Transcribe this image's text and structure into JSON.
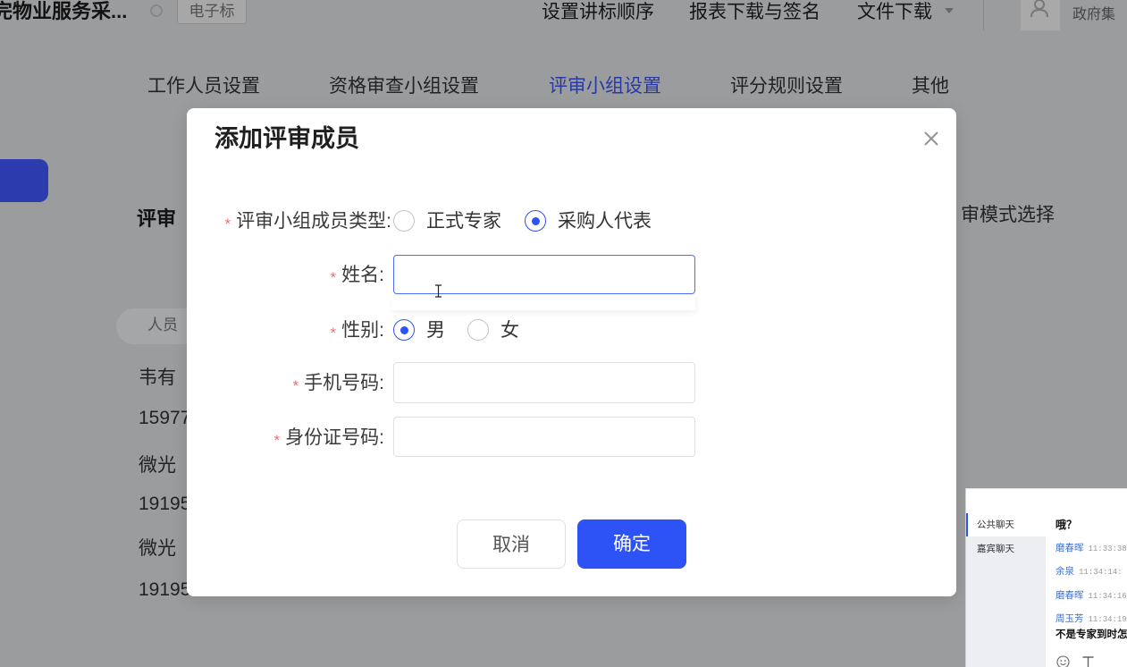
{
  "theme": {
    "primary": "#2d52f5",
    "required": "#f56c6c",
    "chat_name": "#3a6fd0"
  },
  "header": {
    "title": "完物业服务采...",
    "tag": "电子标",
    "nav": [
      "设置讲标顺序",
      "报表下载与签名",
      "文件下载"
    ],
    "user": "政府集",
    "icons": [
      "circle-icon",
      "chevron-down-icon",
      "user-icon"
    ]
  },
  "tabs": {
    "items": [
      "工作人员设置",
      "资格审查小组设置",
      "评审小组设置",
      "评分规则设置",
      "其他"
    ],
    "active_index": 2
  },
  "section": {
    "heading": "评审",
    "right_label": "审模式选择",
    "table_header": "人员"
  },
  "members": [
    {
      "name": "韦有",
      "phone": "15977"
    },
    {
      "name": "微光",
      "phone": "19195"
    },
    {
      "name": "微光",
      "phone": "19195"
    }
  ],
  "dialog": {
    "title": "添加评审成员",
    "required_mark": "*",
    "member_type": {
      "label": "评审小组成员类型:",
      "options": [
        "正式专家",
        "采购人代表"
      ],
      "selected_index": 1
    },
    "name": {
      "label": "姓名:",
      "value": ""
    },
    "gender": {
      "label": "性别:",
      "options": [
        "男",
        "女"
      ],
      "selected_index": 0
    },
    "phone": {
      "label": "手机号码:",
      "value": ""
    },
    "id_number": {
      "label": "身份证号码:",
      "value": ""
    },
    "cancel_label": "取消",
    "confirm_label": "确定",
    "icons": [
      "close-icon",
      "text-cursor-icon"
    ]
  },
  "chat": {
    "tabs": {
      "items": [
        "公共聊天",
        "嘉宾聊天"
      ],
      "active_index": 0
    },
    "top_message": "哦？",
    "messages": [
      {
        "name": "磨春晖",
        "time": "11:33:38"
      },
      {
        "name": "余泉",
        "time": "11:34:14:"
      },
      {
        "name": "磨春晖",
        "time": "11:34:16"
      },
      {
        "name": "周玉芳",
        "time": "11:34:19"
      }
    ],
    "last_text": "不是专家到时怎",
    "toolbar_icons": [
      "smiley-icon",
      "text-format-icon"
    ]
  }
}
